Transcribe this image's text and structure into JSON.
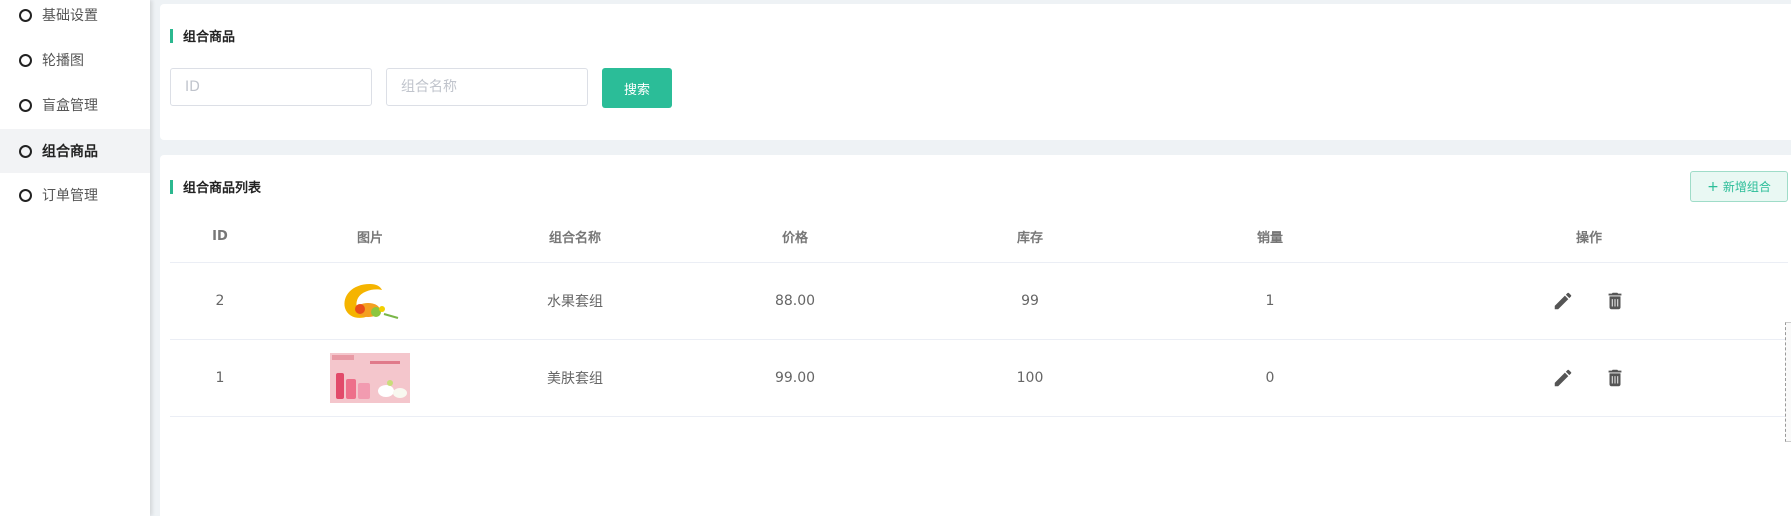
{
  "sidebar": {
    "items": [
      {
        "label": "基础设置",
        "active": false
      },
      {
        "label": "轮播图",
        "active": false
      },
      {
        "label": "盲盒管理",
        "active": false
      },
      {
        "label": "组合商品",
        "active": true
      },
      {
        "label": "订单管理",
        "active": false
      }
    ]
  },
  "search": {
    "title": "组合商品",
    "id_placeholder": "ID",
    "name_placeholder": "组合名称",
    "search_label": "搜索"
  },
  "list": {
    "title": "组合商品列表",
    "add_label": "新增组合",
    "columns": [
      "ID",
      "图片",
      "组合名称",
      "价格",
      "库存",
      "销量",
      "操作"
    ],
    "rows": [
      {
        "id": "2",
        "image": "fruit-combo-image",
        "name": "水果套组",
        "price": "88.00",
        "stock": "99",
        "sales": "1"
      },
      {
        "id": "1",
        "image": "skincare-combo-image",
        "name": "美肤套组",
        "price": "99.00",
        "stock": "100",
        "sales": "0"
      }
    ]
  },
  "icons": {
    "edit": "pencil-icon",
    "delete": "trash-icon",
    "add": "plus-icon"
  },
  "colors": {
    "accent": "#2bbd98",
    "background": "#eef2f5"
  }
}
